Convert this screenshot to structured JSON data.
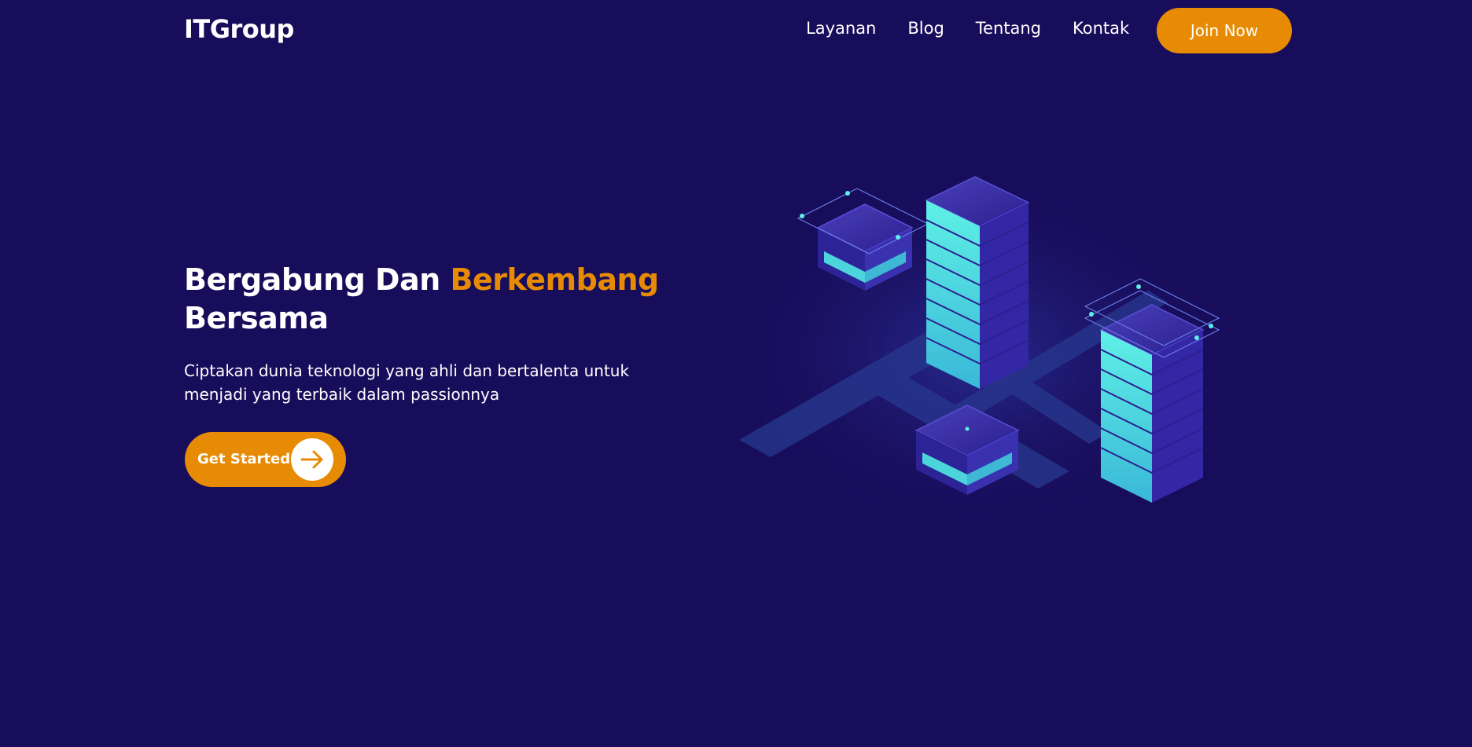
{
  "brand": {
    "logo": "ITGroup"
  },
  "nav": {
    "links": [
      "Layanan",
      "Blog",
      "Tentang",
      "Kontak"
    ],
    "join_label": "Join Now"
  },
  "hero": {
    "title_part1": "Bergabung Dan ",
    "title_accent": "Berkembang",
    "title_part2": "Bersama",
    "subtitle_line1": "Ciptakan dunia teknologi yang ahli dan bertalenta untuk",
    "subtitle_line2": "menjadi yang terbaik dalam passionnya",
    "cta_label": "Get Started",
    "cta_icon": "arrow-right-icon",
    "illustration": "isometric-server-racks-illustration"
  },
  "colors": {
    "background": "#180d5b",
    "accent": "#e88b04",
    "text": "#ffffff",
    "illustration_cyan": "#4fe8e0",
    "illustration_indigo": "#3a2f9e"
  }
}
